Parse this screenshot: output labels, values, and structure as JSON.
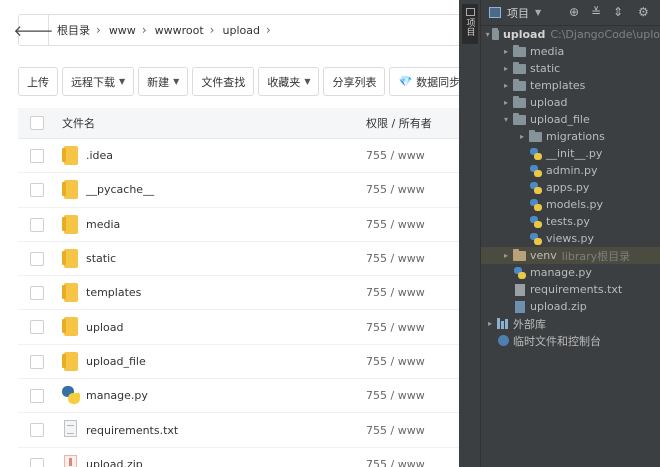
{
  "file_manager": {
    "back_icon": "arrow-left-icon",
    "breadcrumb": [
      "根目录",
      "www",
      "wwwroot",
      "upload"
    ],
    "toolbar": {
      "upload": "上传",
      "remote_download": "远程下载",
      "new": "新建",
      "file_search": "文件查找",
      "favorites": "收藏夹",
      "share_list": "分享列表",
      "data_sync": "数据同步"
    },
    "columns": {
      "name": "文件名",
      "permission": "权限 / 所有者"
    },
    "files": [
      {
        "name": ".idea",
        "type": "folder",
        "perm": "755 / www"
      },
      {
        "name": "__pycache__",
        "type": "folder",
        "perm": "755 / www"
      },
      {
        "name": "media",
        "type": "folder",
        "perm": "755 / www"
      },
      {
        "name": "static",
        "type": "folder",
        "perm": "755 / www"
      },
      {
        "name": "templates",
        "type": "folder",
        "perm": "755 / www"
      },
      {
        "name": "upload",
        "type": "folder",
        "perm": "755 / www"
      },
      {
        "name": "upload_file",
        "type": "folder",
        "perm": "755 / www"
      },
      {
        "name": "manage.py",
        "type": "python",
        "perm": "755 / www"
      },
      {
        "name": "requirements.txt",
        "type": "text",
        "perm": "755 / www"
      },
      {
        "name": "upload.zip",
        "type": "zip",
        "perm": "755 / www"
      }
    ]
  },
  "ide": {
    "side_tab": "项目",
    "header": {
      "label": "项目"
    },
    "tree": [
      {
        "name": "upload",
        "hint": "C:\\DjangoCode\\uplo",
        "kind": "dir",
        "arrow": "▾",
        "level": 0,
        "bold": true
      },
      {
        "name": "media",
        "kind": "dir",
        "arrow": "▸",
        "level": 1
      },
      {
        "name": "static",
        "kind": "dir",
        "arrow": "▸",
        "level": 1
      },
      {
        "name": "templates",
        "kind": "dir",
        "arrow": "▸",
        "level": 1
      },
      {
        "name": "upload",
        "kind": "dir",
        "arrow": "▸",
        "level": 1
      },
      {
        "name": "upload_file",
        "kind": "dir",
        "arrow": "▾",
        "level": 1
      },
      {
        "name": "migrations",
        "kind": "dir",
        "arrow": "▸",
        "level": 2
      },
      {
        "name": "__init__.py",
        "kind": "py",
        "level": 2
      },
      {
        "name": "admin.py",
        "kind": "py",
        "level": 2
      },
      {
        "name": "apps.py",
        "kind": "py",
        "level": 2
      },
      {
        "name": "models.py",
        "kind": "py",
        "level": 2
      },
      {
        "name": "tests.py",
        "kind": "py",
        "level": 2
      },
      {
        "name": "views.py",
        "kind": "py",
        "level": 2
      },
      {
        "name": "venv",
        "hint": "library根目录",
        "kind": "venv",
        "arrow": "▸",
        "level": 1,
        "selected": true
      },
      {
        "name": "manage.py",
        "kind": "py",
        "level": 1
      },
      {
        "name": "requirements.txt",
        "kind": "txt",
        "level": 1
      },
      {
        "name": "upload.zip",
        "kind": "zip",
        "level": 1
      },
      {
        "name": "外部库",
        "kind": "lib",
        "arrow": "▸",
        "level": 0
      },
      {
        "name": "临时文件和控制台",
        "kind": "scratch",
        "level": 0
      }
    ]
  }
}
